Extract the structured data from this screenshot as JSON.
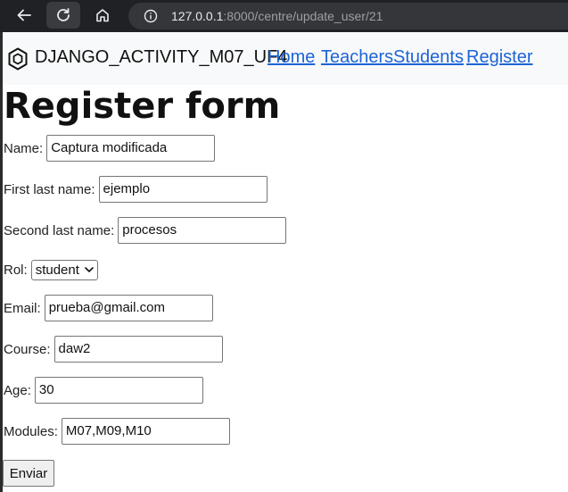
{
  "browser": {
    "url_host": "127.0.0.1",
    "url_rest": ":8000/centre/update_user/21"
  },
  "navbar": {
    "brand": "DJANGO_ACTIVITY_M07_UF4",
    "links": [
      "Home",
      "Teachers",
      "Students",
      "Register"
    ]
  },
  "page": {
    "title": "Register form"
  },
  "form": {
    "name": {
      "label": "Name:",
      "value": "Captura modificada"
    },
    "first_last_name": {
      "label": "First last name:",
      "value": "ejemplo"
    },
    "second_last_name": {
      "label": "Second last name:",
      "value": "procesos"
    },
    "rol": {
      "label": "Rol:",
      "value": "student"
    },
    "email": {
      "label": "Email:",
      "value": "prueba@gmail.com"
    },
    "course": {
      "label": "Course:",
      "value": "daw2"
    },
    "age": {
      "label": "Age:",
      "value": "30"
    },
    "modules": {
      "label": "Modules:",
      "value": "M07,M09,M10"
    },
    "submit_label": "Enviar"
  }
}
